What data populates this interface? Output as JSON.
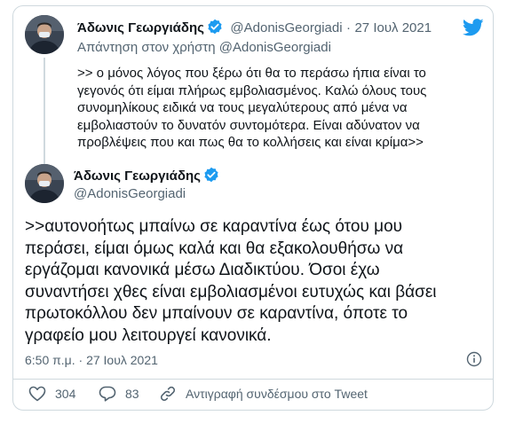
{
  "quoted": {
    "author_name": "Άδωνις Γεωργιάδης",
    "handle": "@AdonisGeorgiadi",
    "separator": "·",
    "date": "27 Ιουλ 2021",
    "reply_to": "Απάντηση στον χρήστη @AdonisGeorgiadi",
    "text_lines": [
      ">> ο μόνος λόγος που ξέρω ότι θα το περάσω ήπια είναι το",
      "γεγονός ότι είμαι πλήρως εμβολιασμένος. Καλώ όλους τους",
      "συνομηλίκους ειδικά να τους μεγαλύτερους από μένα να",
      "εμβολιαστούν το δυνατόν συντομότερα. Είναι αδύνατον να",
      "προβλέψεις που και πως θα το κολλήσεις και είναι κρίμα>>"
    ]
  },
  "tweet": {
    "author_name": "Άδωνις Γεωργιάδης",
    "handle": "@AdonisGeorgiadi",
    "text_lines": [
      ">>αυτονοήτως μπαίνω σε καραντίνα έως ότου μου",
      "περάσει, είμαι όμως καλά και θα εξακολουθήσω να",
      "εργάζομαι κανονικά μέσω Διαδικτύου. Όσοι έχω",
      "συναντήσει χθες είναι εμβολιασμένοι ευτυχώς και βάσει",
      "πρωτοκόλλου δεν μπαίνουν σε καραντίνα, όποτε το",
      "γραφείο μου λειτουργεί κανονικά."
    ],
    "timestamp": "6:50 π.μ. · 27 Ιουλ 2021"
  },
  "actions": {
    "likes": "304",
    "replies": "83",
    "copy_link": "Αντιγραφή συνδέσμου στο Tweet"
  },
  "icons": {
    "brand": "twitter-bird-icon",
    "verified": "verified-badge-icon",
    "info": "info-icon",
    "like": "heart-icon",
    "reply": "reply-bubble-icon",
    "link": "link-icon"
  },
  "colors": {
    "accent": "#1d9bf0",
    "text": "#0f1419",
    "muted": "#536471",
    "border": "#cfd9de"
  }
}
